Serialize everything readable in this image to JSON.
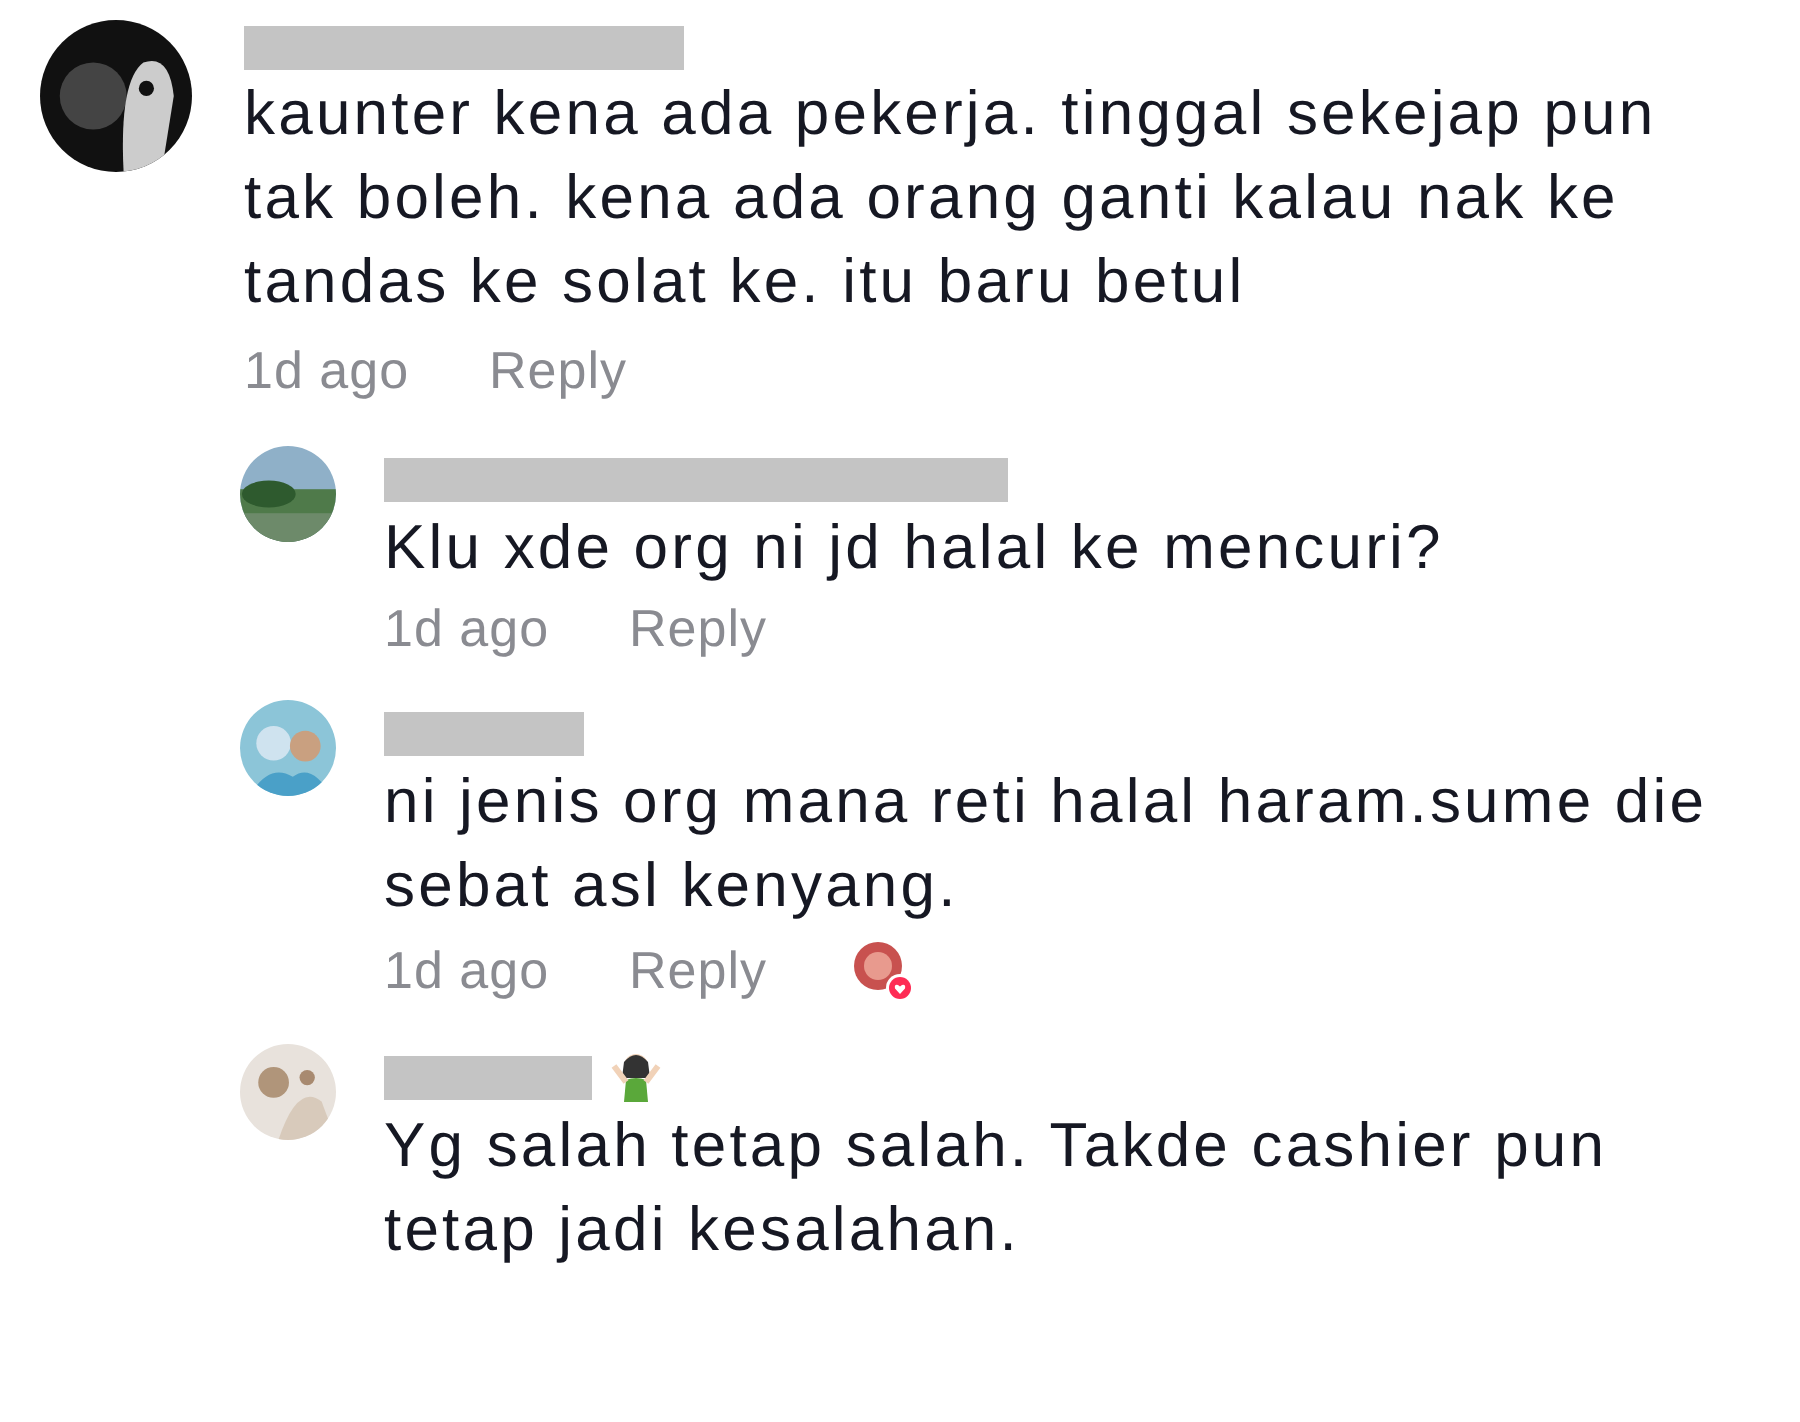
{
  "comments": [
    {
      "text": "kaunter kena ada pekerja. tinggal sekejap pun tak boleh. kena ada orang ganti kalau nak ke tandas ke solat ke. itu baru betul",
      "time": "1d ago",
      "reply": "Reply",
      "replies": [
        {
          "text": "Klu xde org ni jd halal ke mencuri?",
          "time": "1d ago",
          "reply": "Reply"
        },
        {
          "text": "ni jenis org mana reti halal haram.sume die sebat asl kenyang.",
          "time": "1d ago",
          "reply": "Reply",
          "liked_by_creator": true
        },
        {
          "text": "Yg salah tetap salah. Takde cashier pun tetap jadi kesalahan.",
          "name_emoji": true
        }
      ]
    }
  ]
}
